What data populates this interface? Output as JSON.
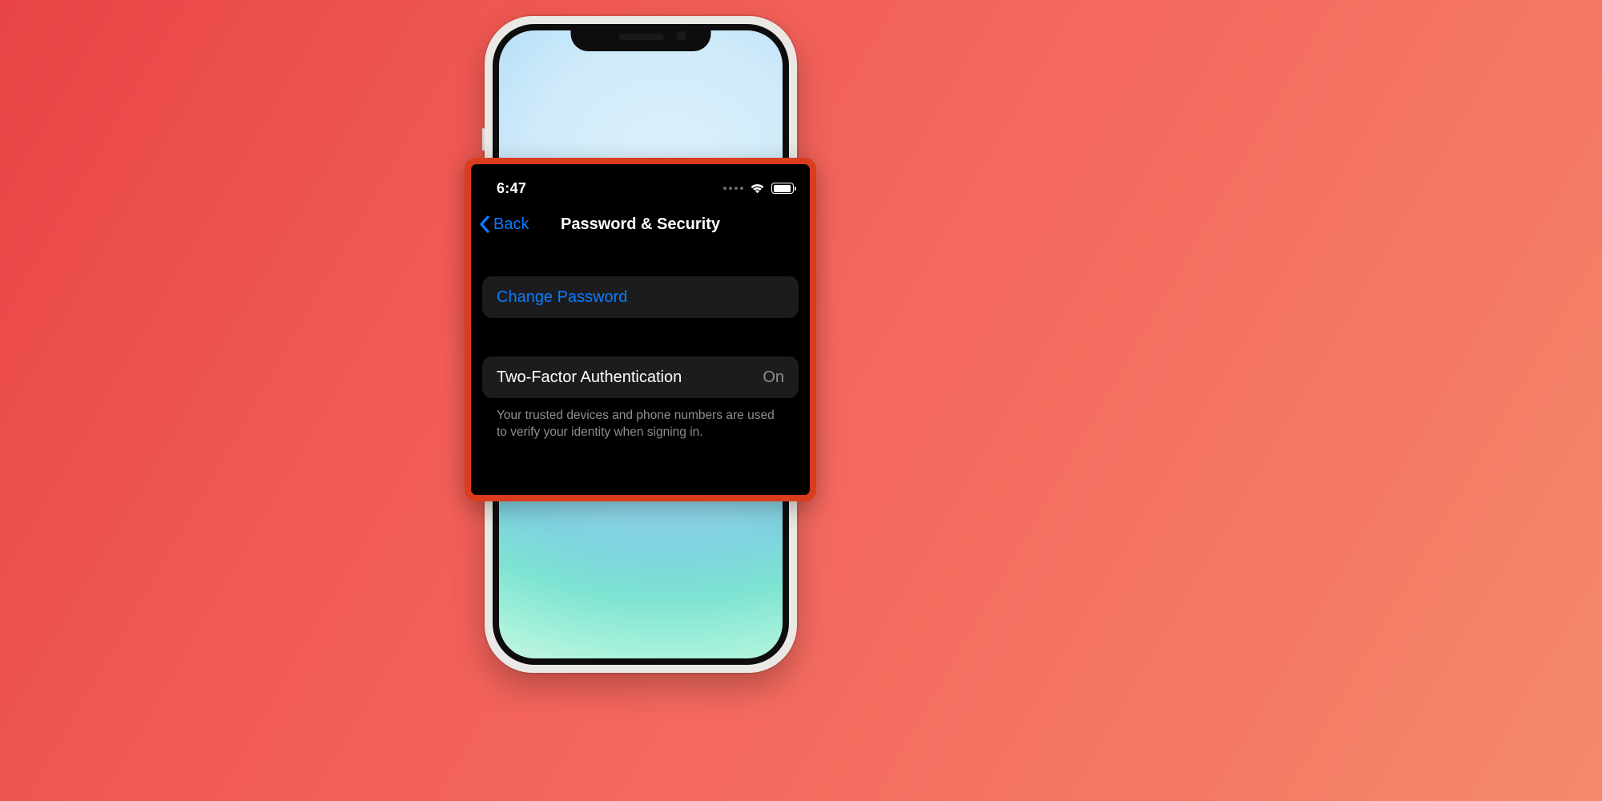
{
  "status": {
    "time": "6:47"
  },
  "nav": {
    "back_label": "Back",
    "title": "Password & Security"
  },
  "rows": {
    "change_password": "Change Password",
    "two_factor_label": "Two-Factor Authentication",
    "two_factor_value": "On",
    "footer": "Your trusted devices and phone numbers are used to verify your identity when signing in."
  }
}
